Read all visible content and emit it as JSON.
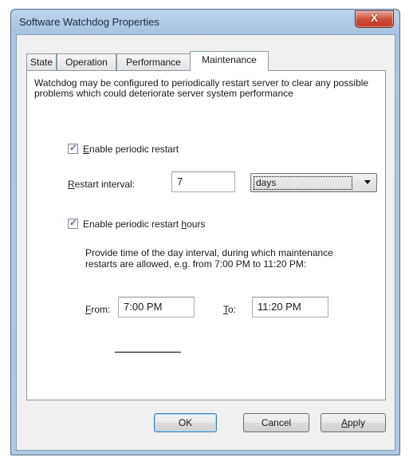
{
  "window": {
    "title": "Software Watchdog Properties",
    "close_glyph": "X"
  },
  "tabs": [
    {
      "label": "State",
      "active": false
    },
    {
      "label": "Operation",
      "active": false
    },
    {
      "label": "Performance",
      "active": false
    },
    {
      "label": "Maintenance",
      "active": true
    }
  ],
  "maintenance": {
    "description": "Watchdog may be configured to periodically restart server to clear any possible problems which could deteriorate server system performance",
    "enable_restart": {
      "mnemonic": "E",
      "rest": "nable periodic restart",
      "checked": true
    },
    "restart_interval": {
      "mnemonic": "R",
      "rest": "estart interval:",
      "value": "7",
      "unit": "days"
    },
    "enable_hours": {
      "before": "Enable periodic restart ",
      "mnemonic": "h",
      "after": "ours",
      "checked": true
    },
    "hours_description": "Provide time of the day interval, during which maintenance restarts are allowed, e.g. from 7:00 PM to 11:20 PM:",
    "from": {
      "mnemonic": "F",
      "rest": "rom:",
      "value": "7:00 PM"
    },
    "to": {
      "mnemonic": "T",
      "rest": "o:",
      "value": "11:20 PM"
    }
  },
  "buttons": {
    "ok": "OK",
    "cancel": "Cancel",
    "apply_mnemonic": "A",
    "apply_rest": "pply"
  },
  "icons": {
    "check": "✓",
    "dropdown": "chevron-down-icon",
    "close": "close-icon"
  }
}
